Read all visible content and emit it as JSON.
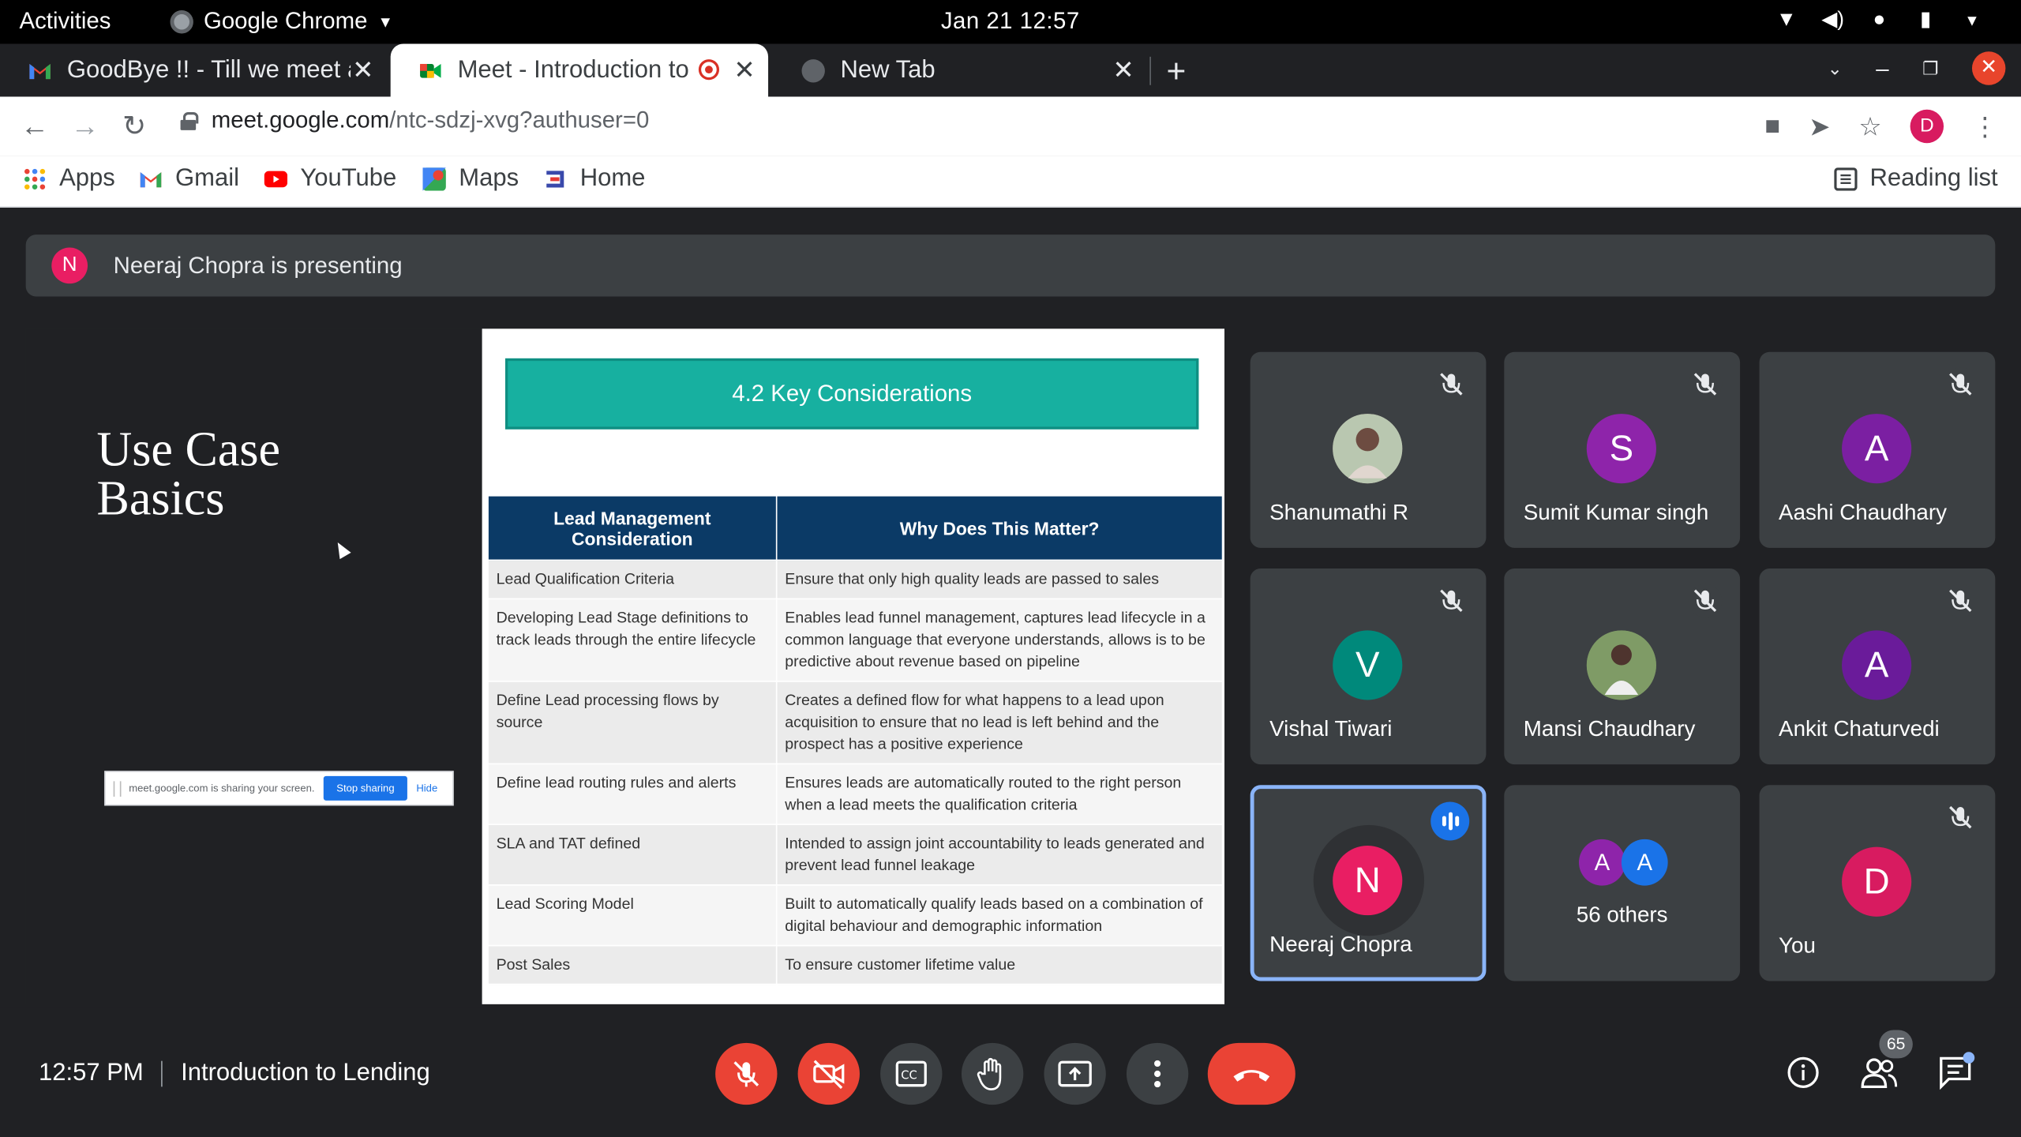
{
  "os_bar": {
    "activities": "Activities",
    "app_name": "Google Chrome",
    "datetime": "Jan 21  12:57"
  },
  "tabs": [
    {
      "title": "GoodBye !! - Till we meet again",
      "active": false
    },
    {
      "title": "Meet - Introduction to Lending",
      "active": true,
      "recording": true
    },
    {
      "title": "New Tab",
      "active": false
    }
  ],
  "omnibox": {
    "host": "meet.google.com",
    "path": "/ntc-sdzj-xvg?authuser=0",
    "profile_initial": "D"
  },
  "bookmarks": [
    "Apps",
    "Gmail",
    "YouTube",
    "Maps",
    "Home"
  ],
  "reading_list": "Reading list",
  "presenting": {
    "avatar_initial": "N",
    "text": "Neeraj Chopra is presenting"
  },
  "share_screen": {
    "left_title_line1": "Use Case",
    "left_title_line2": "Basics",
    "share_notice": "meet.google.com is sharing your screen.",
    "stop_label": "Stop sharing",
    "hide_label": "Hide"
  },
  "slide": {
    "title": "4.2 Key Considerations",
    "headers": [
      "Lead Management Consideration",
      "Why Does This Matter?"
    ],
    "rows": [
      [
        "Lead Qualification Criteria",
        "Ensure that only high quality leads are passed to sales"
      ],
      [
        "Developing  Lead Stage definitions to track leads through the entire lifecycle",
        "Enables lead funnel management, captures lead lifecycle in a common language that everyone understands, allows is to be predictive about revenue based on pipeline"
      ],
      [
        "Define Lead processing flows by source",
        "Creates a defined flow for what happens to a lead upon acquisition to ensure that no lead is left behind and the prospect has a positive experience"
      ],
      [
        "Define lead routing rules and alerts",
        "Ensures leads are automatically routed to the right person when a lead meets the qualification criteria"
      ],
      [
        "SLA and TAT defined",
        "Intended to assign joint accountability to leads generated and prevent lead funnel leakage"
      ],
      [
        "Lead Scoring Model",
        "Built to automatically qualify leads based on a combination of digital behaviour and demographic information"
      ],
      [
        "Post Sales",
        "To ensure customer lifetime value"
      ]
    ]
  },
  "participants": [
    {
      "name": "Shanumathi R",
      "initial": "",
      "color": "#c9b8a8",
      "photo": true
    },
    {
      "name": "Sumit Kumar singh",
      "initial": "S",
      "color": "#8e24aa"
    },
    {
      "name": "Aashi Chaudhary",
      "initial": "A",
      "color": "#7b1fa2"
    },
    {
      "name": "Vishal Tiwari",
      "initial": "V",
      "color": "#00897b"
    },
    {
      "name": "Mansi Chaudhary",
      "initial": "",
      "color": "#6d8a5a",
      "photo": true
    },
    {
      "name": "Ankit Chaturvedi",
      "initial": "A",
      "color": "#6a1b9a"
    },
    {
      "name": "Neeraj Chopra",
      "initial": "N",
      "color": "#e91e63"
    },
    {
      "name": "56 others",
      "initial": "A",
      "color": "#8e24aa"
    },
    {
      "name": "You",
      "initial": "D",
      "color": "#d81b60"
    }
  ],
  "others_avatars": [
    "A",
    "A"
  ],
  "meeting": {
    "time": "12:57 PM",
    "title": "Introduction to Lending"
  },
  "people_count": "65",
  "colors": {
    "accent": "#8ab4f8",
    "danger": "#ea4335",
    "surface": "#3c4043"
  }
}
